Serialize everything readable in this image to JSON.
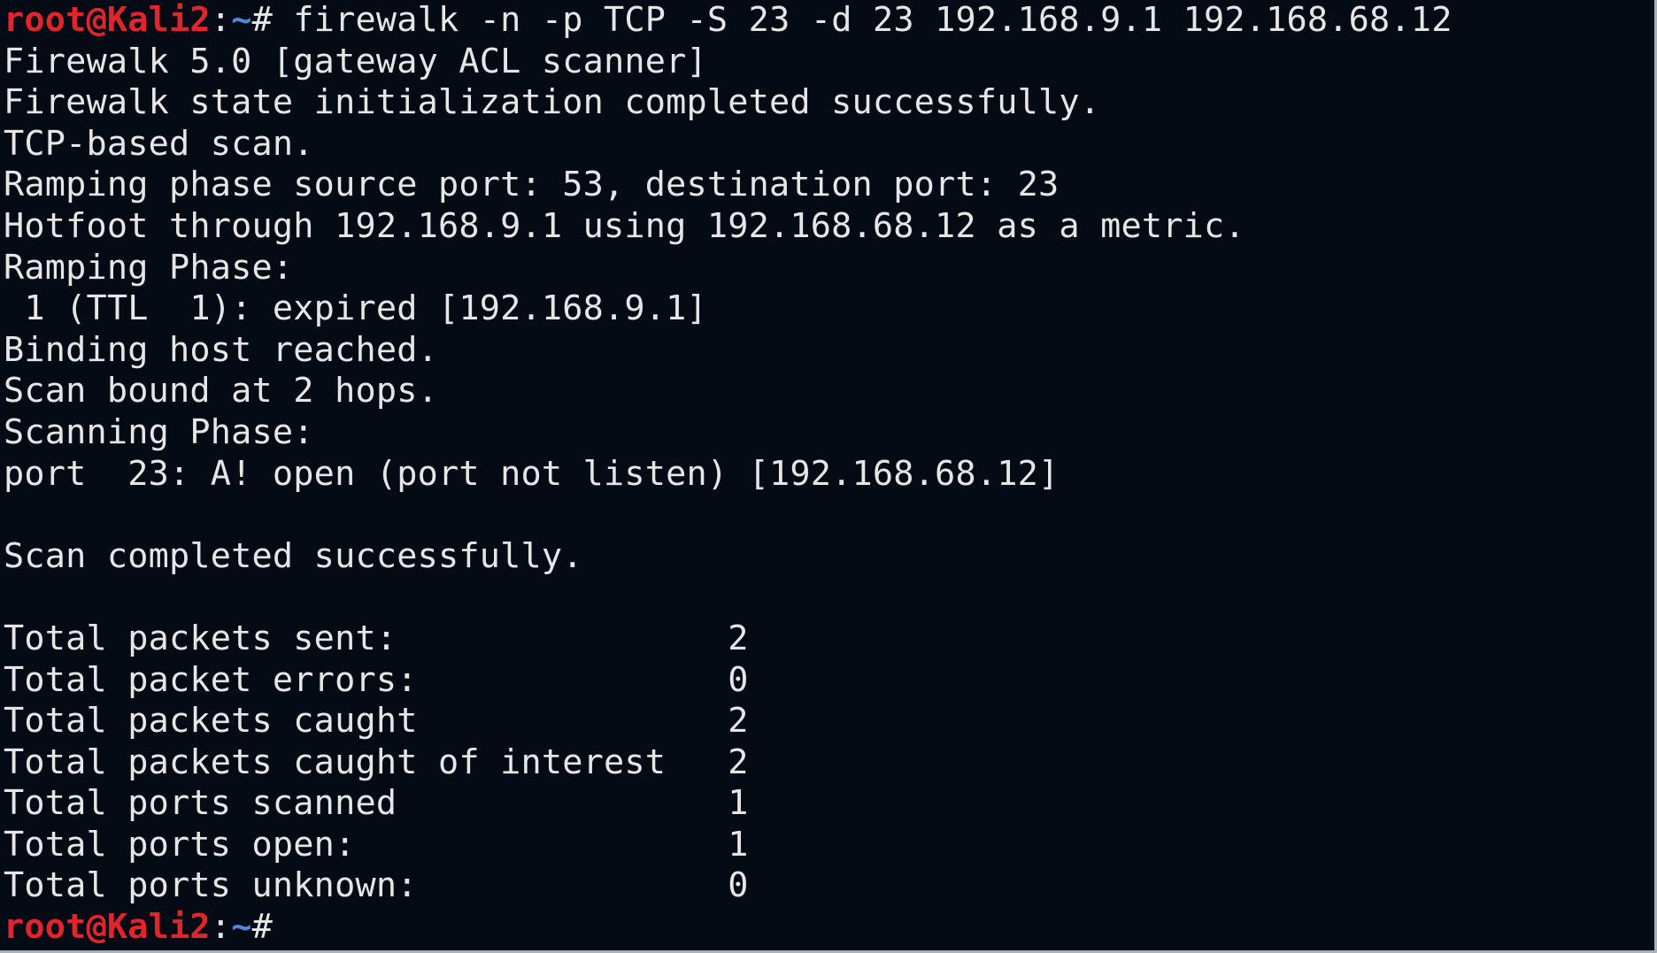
{
  "colors": {
    "background": "#050b14",
    "text": "#e6e6e6",
    "prompt_user": "#e2252b",
    "prompt_path": "#4f86d6"
  },
  "prompt": {
    "user_host": "root@Kali2",
    "colon": ":",
    "path": "~",
    "symbol": "#"
  },
  "command": " firewalk -n -p TCP -S 23 -d 23 192.168.9.1 192.168.68.12",
  "output_lines": [
    "Firewalk 5.0 [gateway ACL scanner]",
    "Firewalk state initialization completed successfully.",
    "TCP-based scan.",
    "Ramping phase source port: 53, destination port: 23",
    "Hotfoot through 192.168.9.1 using 192.168.68.12 as a metric.",
    "Ramping Phase:",
    " 1 (TTL  1): expired [192.168.9.1]",
    "Binding host reached.",
    "Scan bound at 2 hops.",
    "Scanning Phase:",
    "port  23: A! open (port not listen) [192.168.68.12]",
    "",
    "Scan completed successfully.",
    "",
    "Total packets sent:                2",
    "Total packet errors:               0",
    "Total packets caught               2",
    "Total packets caught of interest   2",
    "Total ports scanned                1",
    "Total ports open:                  1",
    "Total ports unknown:               0"
  ]
}
